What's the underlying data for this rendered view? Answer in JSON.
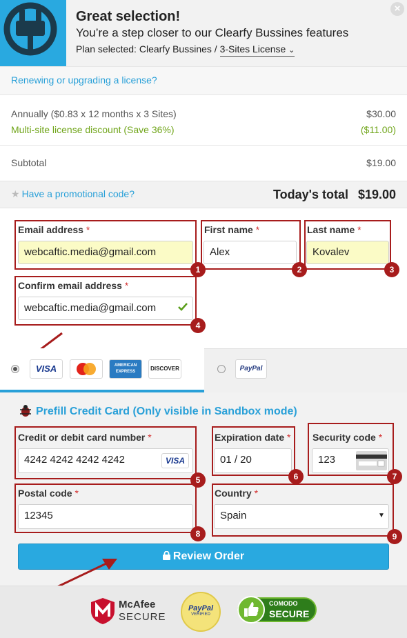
{
  "header": {
    "title": "Great selection!",
    "subtitle": "You’re a step closer to our Clearfy Bussines features",
    "plan_prefix": "Plan selected: ",
    "plan_name": "Clearfy Bussines / ",
    "license": "3-Sites License",
    "close": "×"
  },
  "renew_link": "Renewing or upgrading a license?",
  "pricing": {
    "annual_label": "Annually ($0.83 x 12 months x 3 Sites)",
    "annual_value": "$30.00",
    "discount_label": "Multi-site license discount (Save 36%)",
    "discount_value": "($11.00)",
    "subtotal_label": "Subtotal",
    "subtotal_value": "$19.00",
    "promo_link": "Have a promotional code?",
    "total_label": "Today's total",
    "total_value": "$19.00"
  },
  "form": {
    "email_label": "Email address",
    "email_value": "webcaftic.media@gmail.com",
    "first_label": "First name",
    "first_value": "Alex",
    "last_label": "Last name",
    "last_value": "Kovalev",
    "confirm_label": "Confirm email address",
    "confirm_value": "webcaftic.media@gmail.com",
    "required_mark": "*"
  },
  "payment": {
    "cards": [
      "VISA",
      "MasterCard",
      "AMERICAN EXPRESS",
      "DISCOVER"
    ],
    "paypal": "PayPal",
    "prefill": "Prefill Credit Card (Only visible in Sandbox mode)",
    "card_label": "Credit or debit card number",
    "card_value": "4242 4242 4242 4242",
    "card_brand": "VISA",
    "exp_label": "Expiration date",
    "exp_value": "01 / 20",
    "cvc_label": "Security code",
    "cvc_value": "123",
    "postal_label": "Postal code",
    "postal_value": "12345",
    "country_label": "Country",
    "country_value": "Spain",
    "review_button": "Review Order"
  },
  "badges": [
    "1",
    "2",
    "3",
    "4",
    "5",
    "6",
    "7",
    "8",
    "9"
  ],
  "footer": {
    "mcafee_line1": "McAfee",
    "mcafee_line2": "SECURE",
    "paypal_line1": "PayPal",
    "paypal_line2": "VERIFIED",
    "comodo_line1": "COMODO",
    "comodo_line2": "SECURE"
  },
  "colors": {
    "accent": "#29a9e0",
    "link": "#29a0d8",
    "discount": "#70a51a",
    "highlight": "#a71c1c",
    "required": "#d32f2f"
  }
}
